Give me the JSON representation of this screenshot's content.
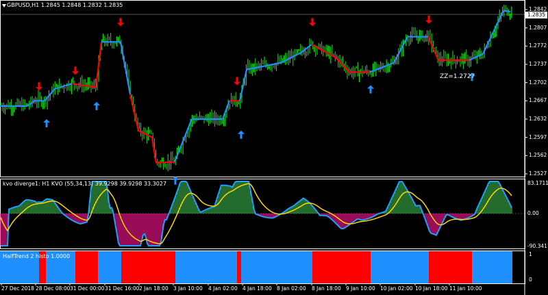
{
  "main_panel": {
    "title": "GBPUSD,H1  1.2845 1.2848 1.2832 1.2835",
    "current_price_label": "1.2835",
    "zz_label": "ZZ=1.2727",
    "price_ticks": [
      "1.2842",
      "1.2807",
      "1.2772",
      "1.2737",
      "1.2702",
      "1.2667",
      "1.2632",
      "1.2597",
      "1.2562",
      "1.2527"
    ]
  },
  "kvo_panel": {
    "title": "kvo diverge1: H1  KVO (55,34,13) 39.9298 39.9298 33.3027",
    "ticks": [
      "83.1711",
      "0.00",
      "-90.3411"
    ]
  },
  "halftrend_panel": {
    "title": "HalfTrend 2 histo 1.0000",
    "ticks": [
      "1",
      "0"
    ]
  },
  "time_axis": [
    "27 Dec 2018",
    "28 Dec 08:00",
    "31 Dec 00:00",
    "31 Dec 16:00",
    "2 Jan 18:00",
    "3 Jan 10:00",
    "4 Jan 02:00",
    "4 Jan 18:00",
    "8 Jan 02:00",
    "8 Jan 18:00",
    "9 Jan 10:00",
    "10 Jan 02:00",
    "10 Jan 18:00",
    "11 Jan 10:00"
  ],
  "colors": {
    "bull": "#00ff00",
    "bear": "#33cc33",
    "uptrend": "#1e90ff",
    "downtrend": "#ff0000",
    "kvo_line": "#1ea0ff",
    "signal_line": "#ffd700",
    "histo_pos": "#3cb44b",
    "histo_neg": "#ff1493"
  },
  "chart_data": [
    {
      "type": "line",
      "name": "GBPUSD H1",
      "ylim": [
        1.2527,
        1.2842
      ],
      "halftrend_path": [
        {
          "x": 0,
          "y": 1.2657,
          "trend": "up"
        },
        {
          "x": 40,
          "y": 1.2657,
          "trend": "up"
        },
        {
          "x": 50,
          "y": 1.2667,
          "trend": "up"
        },
        {
          "x": 65,
          "y": 1.2667,
          "trend": "up"
        },
        {
          "x": 80,
          "y": 1.269,
          "trend": "up"
        },
        {
          "x": 105,
          "y": 1.27,
          "trend": "down"
        },
        {
          "x": 140,
          "y": 1.2693,
          "trend": "down"
        },
        {
          "x": 148,
          "y": 1.278,
          "trend": "up"
        },
        {
          "x": 176,
          "y": 1.278,
          "trend": "up"
        },
        {
          "x": 190,
          "y": 1.268,
          "trend": "down"
        },
        {
          "x": 202,
          "y": 1.261,
          "trend": "down"
        },
        {
          "x": 222,
          "y": 1.2597,
          "trend": "down"
        },
        {
          "x": 228,
          "y": 1.2548,
          "trend": "down"
        },
        {
          "x": 255,
          "y": 1.255,
          "trend": "up"
        },
        {
          "x": 280,
          "y": 1.2632,
          "trend": "up"
        },
        {
          "x": 325,
          "y": 1.2632,
          "trend": "up"
        },
        {
          "x": 335,
          "y": 1.2667,
          "trend": "down"
        },
        {
          "x": 350,
          "y": 1.2667,
          "trend": "up"
        },
        {
          "x": 360,
          "y": 1.2727,
          "trend": "up"
        },
        {
          "x": 410,
          "y": 1.274,
          "trend": "up"
        },
        {
          "x": 440,
          "y": 1.276,
          "trend": "up"
        },
        {
          "x": 455,
          "y": 1.2775,
          "trend": "down"
        },
        {
          "x": 490,
          "y": 1.275,
          "trend": "down"
        },
        {
          "x": 510,
          "y": 1.2722,
          "trend": "down"
        },
        {
          "x": 540,
          "y": 1.2722,
          "trend": "up"
        },
        {
          "x": 575,
          "y": 1.274,
          "trend": "up"
        },
        {
          "x": 595,
          "y": 1.279,
          "trend": "up"
        },
        {
          "x": 625,
          "y": 1.279,
          "trend": "down"
        },
        {
          "x": 640,
          "y": 1.2745,
          "trend": "down"
        },
        {
          "x": 685,
          "y": 1.2745,
          "trend": "up"
        },
        {
          "x": 705,
          "y": 1.2757,
          "trend": "up"
        },
        {
          "x": 735,
          "y": 1.284,
          "trend": "up"
        },
        {
          "x": 745,
          "y": 1.2838,
          "trend": "up"
        }
      ],
      "sell_arrows": [
        {
          "x": 57,
          "y": 1.2687
        },
        {
          "x": 110,
          "y": 1.2717
        },
        {
          "x": 176,
          "y": 1.281
        },
        {
          "x": 346,
          "y": 1.2697
        },
        {
          "x": 456,
          "y": 1.281
        },
        {
          "x": 626,
          "y": 1.2815
        }
      ],
      "buy_arrows": [
        {
          "x": 68,
          "y": 1.2632
        },
        {
          "x": 141,
          "y": 1.2665
        },
        {
          "x": 256,
          "y": 1.2522
        },
        {
          "x": 352,
          "y": 1.261
        },
        {
          "x": 541,
          "y": 1.2697
        },
        {
          "x": 689,
          "y": 1.2721
        }
      ]
    },
    {
      "type": "area",
      "name": "KVO",
      "ylim": [
        -90.3411,
        83.1711
      ]
    },
    {
      "type": "bar",
      "name": "HalfTrend 2 histo",
      "ylim": [
        0,
        1
      ],
      "segments": [
        {
          "from": 0,
          "to": 57,
          "trend": "up"
        },
        {
          "from": 57,
          "to": 67,
          "trend": "down"
        },
        {
          "from": 67,
          "to": 110,
          "trend": "up"
        },
        {
          "from": 110,
          "to": 143,
          "trend": "down"
        },
        {
          "from": 143,
          "to": 177,
          "trend": "up"
        },
        {
          "from": 177,
          "to": 256,
          "trend": "down"
        },
        {
          "from": 256,
          "to": 346,
          "trend": "up"
        },
        {
          "from": 346,
          "to": 352,
          "trend": "down"
        },
        {
          "from": 352,
          "to": 456,
          "trend": "up"
        },
        {
          "from": 456,
          "to": 541,
          "trend": "down"
        },
        {
          "from": 541,
          "to": 626,
          "trend": "up"
        },
        {
          "from": 626,
          "to": 689,
          "trend": "down"
        },
        {
          "from": 689,
          "to": 748,
          "trend": "up"
        }
      ]
    }
  ]
}
